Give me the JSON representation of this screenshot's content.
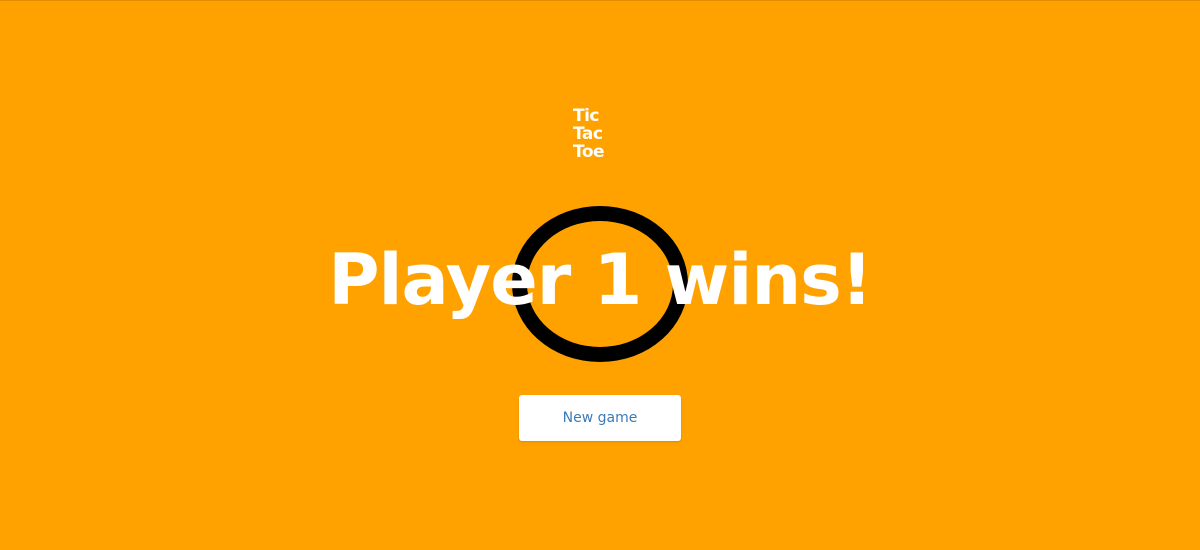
{
  "logo": {
    "lines": [
      "Tic",
      "Tac",
      "Toe"
    ]
  },
  "game": {
    "winner_mark": "O",
    "result_text": "Player 1 wins!",
    "new_game_label": "New game"
  },
  "colors": {
    "background": "#ffa200",
    "text": "#ffffff",
    "mark": "#000000",
    "button_text": "#3c7ab8"
  },
  "icons": {
    "winner_mark": "o-mark-icon"
  }
}
